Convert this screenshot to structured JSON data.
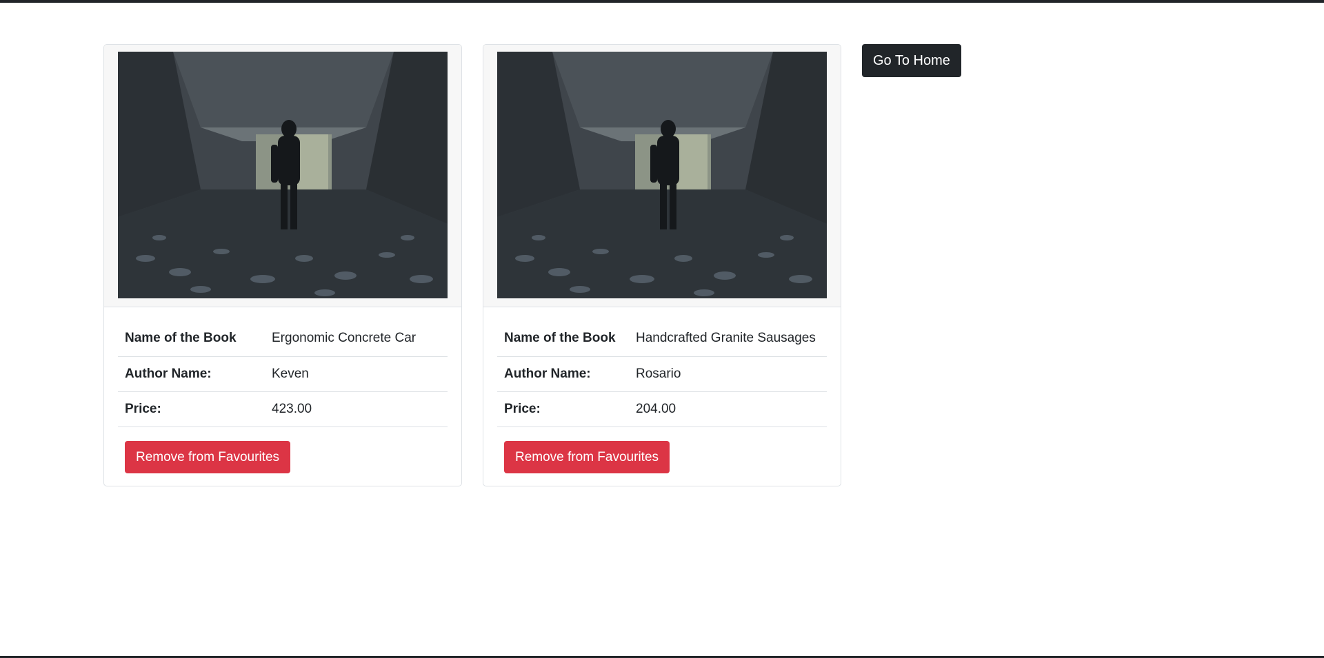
{
  "home_button": {
    "label": "Go To Home"
  },
  "favourites": [
    {
      "fields": [
        {
          "key": "Name of the Book",
          "value": "Ergonomic Concrete Car"
        },
        {
          "key": "Author Name:",
          "value": "Keven"
        },
        {
          "key": "Price:",
          "value": "423.00"
        }
      ],
      "remove_label": "Remove from Favourites"
    },
    {
      "fields": [
        {
          "key": "Name of the Book",
          "value": "Handcrafted Granite Sausages"
        },
        {
          "key": "Author Name:",
          "value": "Rosario"
        },
        {
          "key": "Price:",
          "value": "204.00"
        }
      ],
      "remove_label": "Remove from Favourites"
    }
  ],
  "colors": {
    "danger": "#dc3545",
    "dark": "#212529",
    "border": "#dee2e6"
  }
}
